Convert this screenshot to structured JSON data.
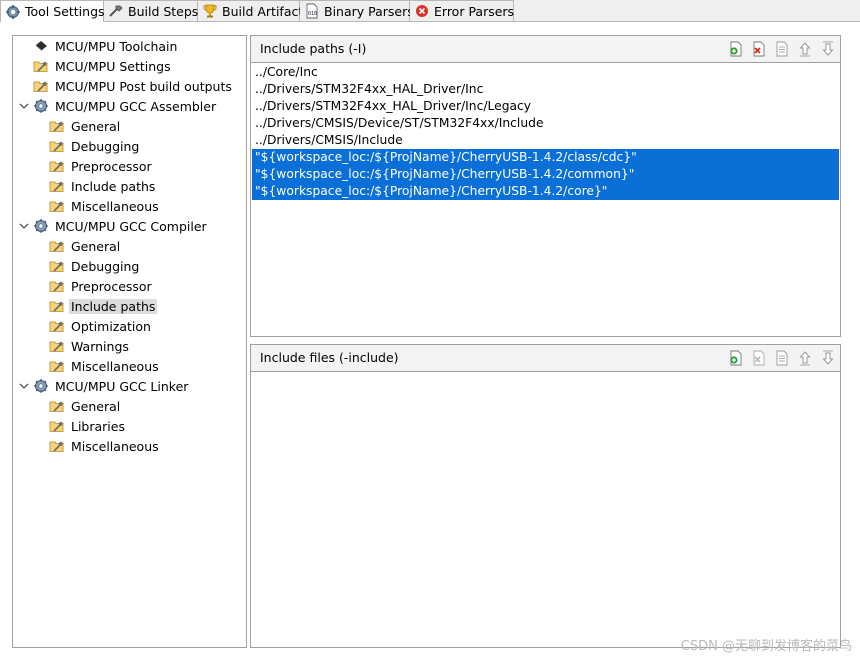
{
  "tabs": [
    {
      "label": "Tool Settings",
      "icon": "tool-settings-icon",
      "active": true
    },
    {
      "label": "Build Steps",
      "icon": "build-steps-icon",
      "active": false
    },
    {
      "label": "Build Artifact",
      "icon": "trophy-icon",
      "active": false
    },
    {
      "label": "Binary Parsers",
      "icon": "binary-icon",
      "active": false
    },
    {
      "label": "Error Parsers",
      "icon": "error-icon",
      "active": false
    }
  ],
  "tree": {
    "items": [
      {
        "label": "MCU/MPU Toolchain"
      },
      {
        "label": "MCU/MPU Settings"
      },
      {
        "label": "MCU/MPU Post build outputs"
      },
      {
        "label": "MCU/MPU GCC Assembler"
      },
      {
        "label": "General"
      },
      {
        "label": "Debugging"
      },
      {
        "label": "Preprocessor"
      },
      {
        "label": "Include paths"
      },
      {
        "label": "Miscellaneous"
      },
      {
        "label": "MCU/MPU GCC Compiler"
      },
      {
        "label": "General"
      },
      {
        "label": "Debugging"
      },
      {
        "label": "Preprocessor"
      },
      {
        "label": "Include paths"
      },
      {
        "label": "Optimization"
      },
      {
        "label": "Warnings"
      },
      {
        "label": "Miscellaneous"
      },
      {
        "label": "MCU/MPU GCC Linker"
      },
      {
        "label": "General"
      },
      {
        "label": "Libraries"
      },
      {
        "label": "Miscellaneous"
      }
    ]
  },
  "include_paths": {
    "title": "Include paths (-I)",
    "items": [
      {
        "text": "../Core/Inc",
        "selected": false
      },
      {
        "text": "../Drivers/STM32F4xx_HAL_Driver/Inc",
        "selected": false
      },
      {
        "text": "../Drivers/STM32F4xx_HAL_Driver/Inc/Legacy",
        "selected": false
      },
      {
        "text": "../Drivers/CMSIS/Device/ST/STM32F4xx/Include",
        "selected": false
      },
      {
        "text": "../Drivers/CMSIS/Include",
        "selected": false
      },
      {
        "text": "\"${workspace_loc:/${ProjName}/CherryUSB-1.4.2/class/cdc}\"",
        "selected": true
      },
      {
        "text": "\"${workspace_loc:/${ProjName}/CherryUSB-1.4.2/common}\"",
        "selected": true
      },
      {
        "text": "\"${workspace_loc:/${ProjName}/CherryUSB-1.4.2/core}\"",
        "selected": true
      }
    ]
  },
  "include_files": {
    "title": "Include files (-include)",
    "items": []
  },
  "toolbar_icons": [
    "add-icon",
    "delete-icon",
    "edit-icon",
    "move-up-icon",
    "move-down-icon"
  ],
  "watermark": "CSDN @无聊到发博客的菜鸟",
  "colors": {
    "selection": "#0a6fd6",
    "header_bg": "#f3f3f3",
    "border": "#a0a0a0"
  }
}
